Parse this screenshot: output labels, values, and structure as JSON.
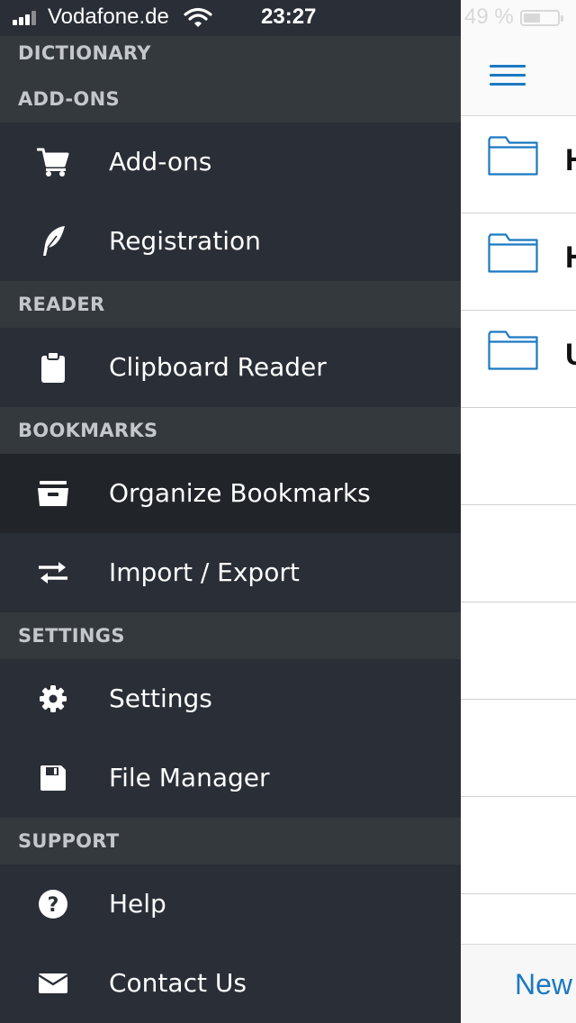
{
  "status_bar": {
    "carrier": "Vodafone.de",
    "time": "23:27",
    "battery_percent": "49 %",
    "battery_level": 0.49
  },
  "drawer": {
    "sections": {
      "dictionary": "DICTIONARY",
      "addons": "ADD-ONS",
      "reader": "READER",
      "bookmarks": "BOOKMARKS",
      "settings": "SETTINGS",
      "support": "SUPPORT"
    },
    "items": {
      "addons": {
        "label": "Add-ons",
        "icon": "cart-icon"
      },
      "registration": {
        "label": "Registration",
        "icon": "feather-icon"
      },
      "clipboard_reader": {
        "label": "Clipboard Reader",
        "icon": "clipboard-icon"
      },
      "organize_bookmarks": {
        "label": "Organize Bookmarks",
        "icon": "archive-box-icon",
        "active": true
      },
      "import_export": {
        "label": "Import / Export",
        "icon": "swap-arrows-icon"
      },
      "settings": {
        "label": "Settings",
        "icon": "gear-icon"
      },
      "file_manager": {
        "label": "File Manager",
        "icon": "floppy-disk-icon"
      },
      "help": {
        "label": "Help",
        "icon": "question-circle-icon"
      },
      "contact_us": {
        "label": "Contact Us",
        "icon": "envelope-icon"
      }
    }
  },
  "background_screen": {
    "folder_rows": [
      {
        "letter": "H",
        "icon": "folder-icon"
      },
      {
        "letter": "H",
        "icon": "folder-icon"
      },
      {
        "letter": "U",
        "icon": "folder-icon"
      }
    ],
    "toolbar": {
      "new_label": "New"
    }
  },
  "colors": {
    "drawer_bg": "#2a2e36",
    "section_bg": "#33393c",
    "active_bg": "#212429",
    "accent": "#1b79c2"
  }
}
